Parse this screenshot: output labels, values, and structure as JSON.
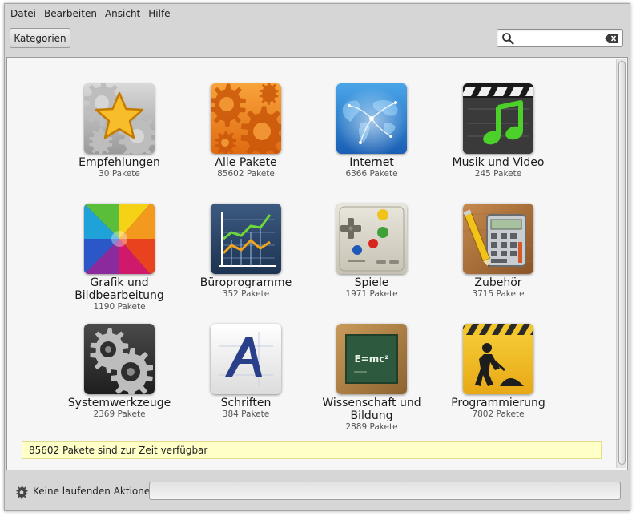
{
  "menubar": {
    "items": [
      "Datei",
      "Bearbeiten",
      "Ansicht",
      "Hilfe"
    ]
  },
  "toolbar": {
    "kategorien_label": "Kategorien",
    "search": {
      "value": "",
      "placeholder": ""
    }
  },
  "categories": [
    {
      "name": "Empfehlungen",
      "count": "30 Pakete",
      "icon": "star-icon"
    },
    {
      "name": "Alle Pakete",
      "count": "85602 Pakete",
      "icon": "gears-icon"
    },
    {
      "name": "Internet",
      "count": "6366 Pakete",
      "icon": "globe-icon"
    },
    {
      "name": "Musik und Video",
      "count": "245 Pakete",
      "icon": "clapperboard-music-icon"
    },
    {
      "name": "Grafik und Bildbearbeitung",
      "count": "1190 Pakete",
      "icon": "color-wheel-icon"
    },
    {
      "name": "Büroprogramme",
      "count": "352 Pakete",
      "icon": "line-chart-icon"
    },
    {
      "name": "Spiele",
      "count": "1971 Pakete",
      "icon": "gamepad-icon"
    },
    {
      "name": "Zubehör",
      "count": "3715 Pakete",
      "icon": "calculator-icon"
    },
    {
      "name": "Systemwerkzeuge",
      "count": "2369 Pakete",
      "icon": "system-gears-icon"
    },
    {
      "name": "Schriften",
      "count": "384 Pakete",
      "icon": "font-icon"
    },
    {
      "name": "Wissenschaft und Bildung",
      "count": "2889 Pakete",
      "icon": "chalkboard-icon"
    },
    {
      "name": "Programmierung",
      "count": "7802 Pakete",
      "icon": "construction-icon"
    }
  ],
  "icon_text": {
    "chalkboard": "E=mc²"
  },
  "notice": "85602 Pakete sind zur Zeit verfügbar",
  "statusbar": {
    "text": "Keine laufenden Aktionen"
  },
  "colors": {
    "window_bg": "#d6d6d6",
    "content_bg": "#f6f6f6",
    "notice_bg": "#ffffc8",
    "notice_border": "#e0dc8a"
  }
}
